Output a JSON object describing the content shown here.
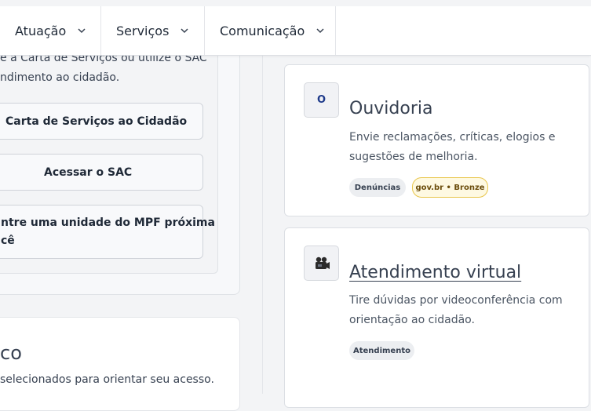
{
  "nav": {
    "items": [
      {
        "label": "Atuação"
      },
      {
        "label": "Serviços"
      },
      {
        "label": "Comunicação"
      }
    ]
  },
  "left": {
    "intro_line1": "e a Carta de Serviços ou utilize o SAC",
    "intro_line2": "ndimento ao cidadão.",
    "buttons": [
      {
        "label": "Carta de Serviços ao Cidadão"
      },
      {
        "label": "Acessar o SAC"
      },
      {
        "label_line1": "ntre uma unidade do MPF próxima",
        "label_line2": "cê"
      }
    ],
    "card2": {
      "title": "co",
      "desc": "selecionados para orientar seu acesso."
    }
  },
  "cards": [
    {
      "icon_letter": "O",
      "icon": "letter-o-icon",
      "title": "Ouvidoria",
      "desc_line1": "Envie reclamações, críticas, elogios e",
      "desc_line2": "sugestões de melhoria.",
      "badges": [
        {
          "label": "Denúncias",
          "style": "gray"
        },
        {
          "label": "gov.br • Bronze",
          "style": "gold"
        }
      ]
    },
    {
      "icon": "video-camera-icon",
      "title": "Atendimento virtual",
      "desc_line1": "Tire dúvidas por videoconferência com",
      "desc_line2": "orientação ao cidadão.",
      "badges": [
        {
          "label": "Atendimento",
          "style": "gray"
        }
      ]
    }
  ],
  "colors": {
    "background": "#f3f4f6",
    "card": "#ffffff",
    "gold_border": "#e8c54a",
    "icon_letter": "#1e3a8a"
  }
}
